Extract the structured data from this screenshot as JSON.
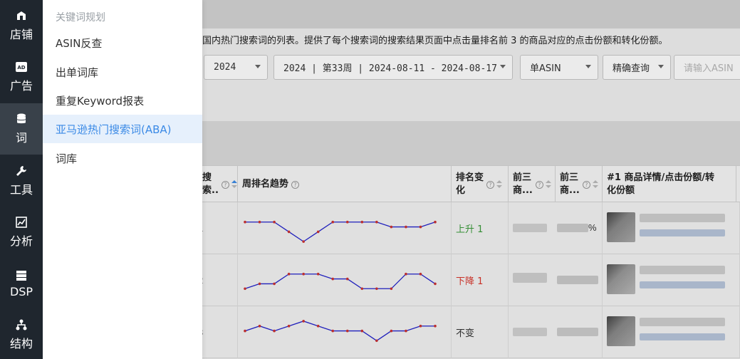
{
  "rail": {
    "items": [
      {
        "label": "店铺",
        "icon": "store-icon"
      },
      {
        "label": "广告",
        "icon": "ad-icon"
      },
      {
        "label": "词",
        "icon": "database-icon"
      },
      {
        "label": "工具",
        "icon": "wrench-icon"
      },
      {
        "label": "分析",
        "icon": "chart-icon"
      },
      {
        "label": "DSP",
        "icon": "server-icon"
      },
      {
        "label": "结构",
        "icon": "hierarchy-icon"
      }
    ]
  },
  "submenu": {
    "heading": "关键词规划",
    "items": [
      {
        "label": "ASIN反查"
      },
      {
        "label": "出单词库"
      },
      {
        "label": "重复Keyword报表"
      },
      {
        "label": "亚马逊热门搜索词(ABA)"
      },
      {
        "label": "词库"
      }
    ]
  },
  "main": {
    "description": "国内热门搜索词的列表。提供了每个搜索词的搜索结果页面中点击量排名前 3 的商品对应的点击份额和转化份额。",
    "filters": {
      "year": "2024",
      "week": "2024 | 第33周 | 2024-08-11 - 2024-08-17",
      "mode": "单ASIN",
      "match": "精确查询",
      "input_placeholder": "请输入ASIN"
    },
    "table": {
      "columns": [
        {
          "label": "搜\n索.."
        },
        {
          "label": "周排名趋势"
        },
        {
          "label": "排名变\n化"
        },
        {
          "label": "前三\n商..."
        },
        {
          "label": "前三\n商..."
        },
        {
          "label": "#1 商品详情/点击份额/转\n化份额"
        }
      ],
      "rows": [
        {
          "rank_change": "上升 1",
          "direction": "up",
          "trend": [
            3,
            3,
            3,
            5,
            7,
            5,
            3,
            3,
            3,
            3,
            4,
            4,
            4,
            3
          ],
          "share_suffix": "%"
        },
        {
          "rank_change": "下降 1",
          "direction": "down",
          "trend": [
            6,
            5,
            5,
            3,
            3,
            3,
            4,
            4,
            6,
            6,
            6,
            3,
            3,
            5
          ],
          "share_suffix": ""
        },
        {
          "rank_change": "不变",
          "direction": "same",
          "trend": [
            4,
            3,
            4,
            3,
            2,
            3,
            4,
            4,
            4,
            6,
            4,
            4,
            3,
            3
          ],
          "share_suffix": ""
        }
      ]
    }
  },
  "colors": {
    "rail_bg": "#1f262e",
    "active_blue": "#3b8ae6",
    "rank_up": "#3a9b3a",
    "rank_down": "#d9362c",
    "trend_line": "#2222cc",
    "trend_point": "#cc3333"
  }
}
